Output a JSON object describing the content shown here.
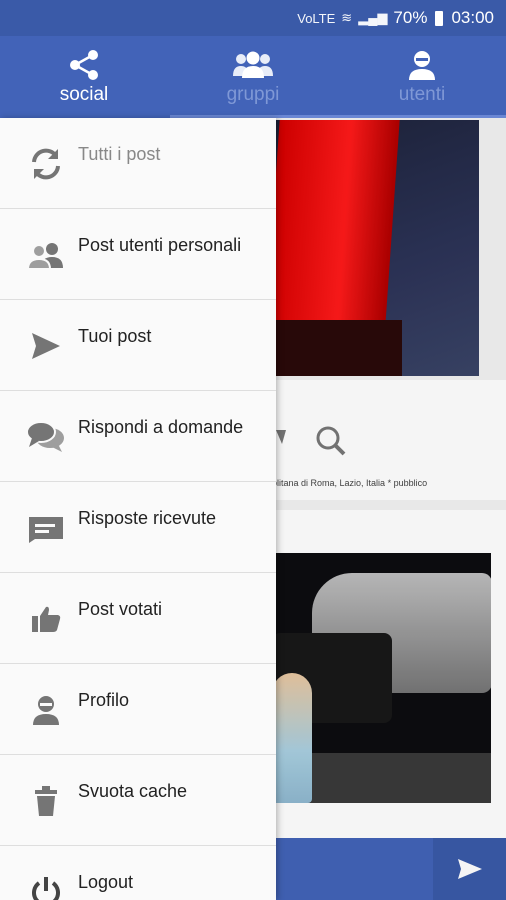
{
  "status_bar": {
    "network": "VoLTE",
    "battery": "70%",
    "time": "03:00"
  },
  "tabs": [
    {
      "label": "social",
      "icon": "share-icon"
    },
    {
      "label": "gruppi",
      "icon": "group-icon"
    },
    {
      "label": "utenti",
      "icon": "user-icon"
    }
  ],
  "background_post": {
    "location": "olitana di Roma, Lazio, Italia * pubblico"
  },
  "drawer": {
    "items": [
      {
        "label": "Tutti i post",
        "icon": "refresh-icon"
      },
      {
        "label": "Post utenti personali",
        "icon": "users-icon"
      },
      {
        "label": "Tuoi post",
        "icon": "send-icon"
      },
      {
        "label": "Rispondi a domande",
        "icon": "chat-bubbles-icon"
      },
      {
        "label": "Risposte ricevute",
        "icon": "message-icon"
      },
      {
        "label": "Post votati",
        "icon": "thumbs-up-icon"
      },
      {
        "label": "Profilo",
        "icon": "profile-icon"
      },
      {
        "label": "Svuota cache",
        "icon": "trash-icon"
      },
      {
        "label": "Logout",
        "icon": "power-icon"
      }
    ]
  },
  "colors": {
    "primary": "#4263b8",
    "status_bar": "#3a5aa8",
    "drawer_bg": "#fafafa",
    "icon_grey": "#757575"
  }
}
